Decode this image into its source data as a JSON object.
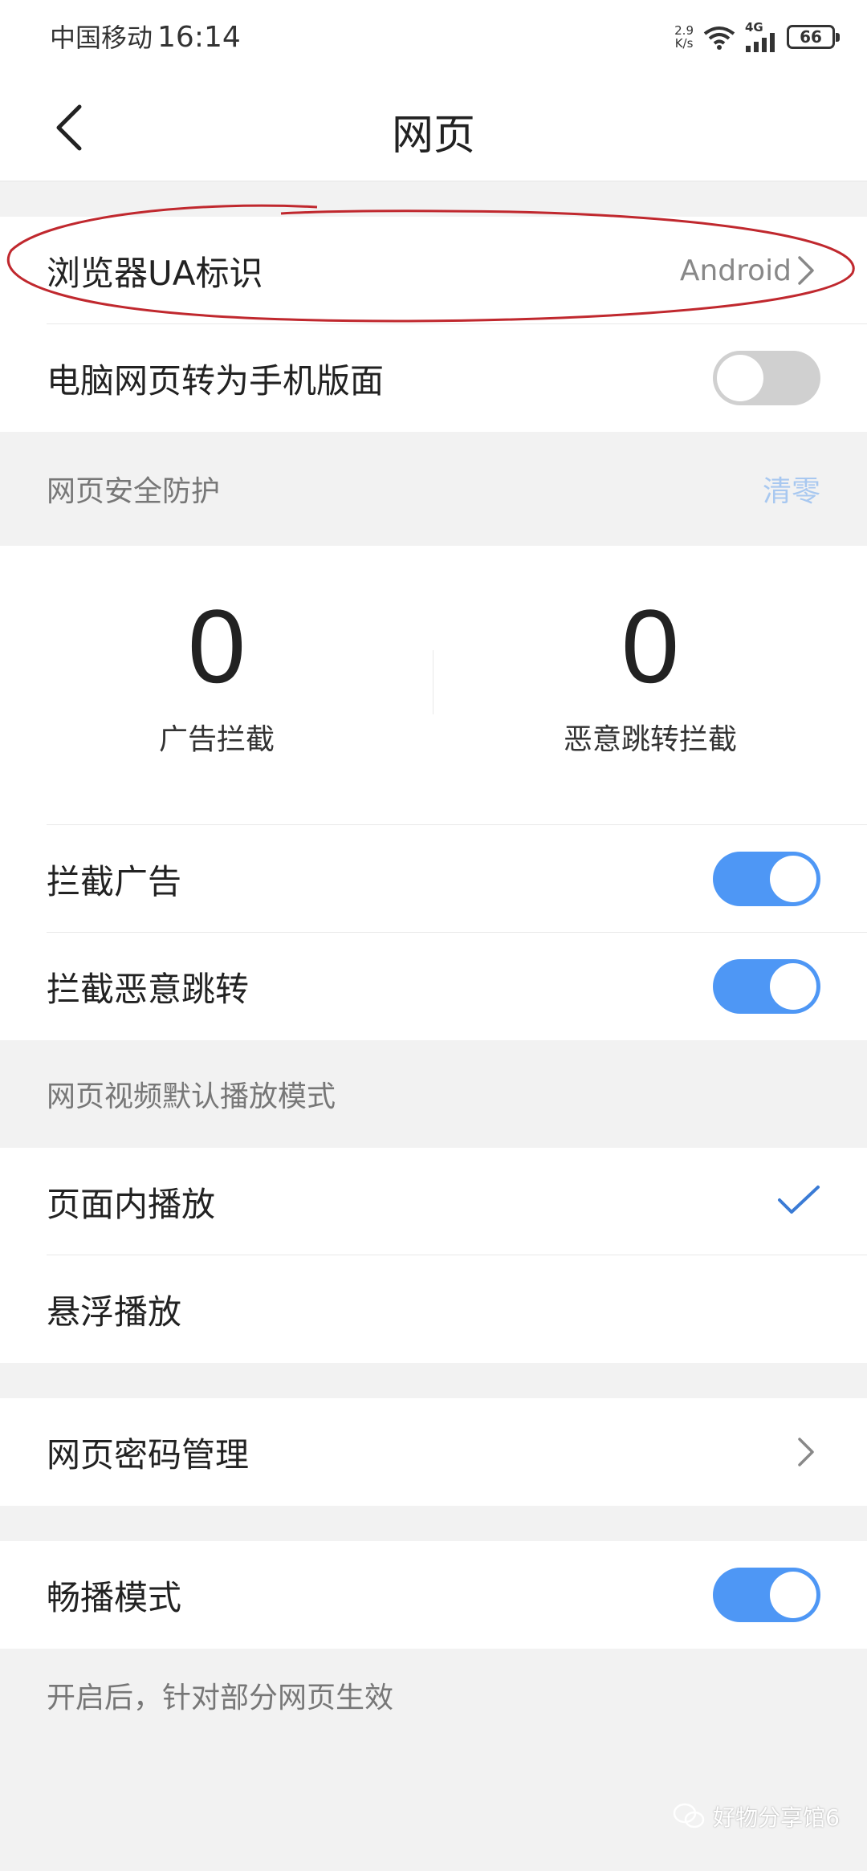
{
  "status_bar": {
    "carrier": "中国移动",
    "time": "16:14",
    "net_speed_value": "2.9",
    "net_speed_unit": "K/s",
    "network": "4G",
    "battery": "66"
  },
  "header": {
    "title": "网页"
  },
  "ua": {
    "label": "浏览器UA标识",
    "value": "Android"
  },
  "mobile_view": {
    "label": "电脑网页转为手机版面",
    "enabled": false
  },
  "security": {
    "section_title": "网页安全防护",
    "clear_label": "清零",
    "ads_blocked_count": "0",
    "ads_blocked_label": "广告拦截",
    "redirects_blocked_count": "0",
    "redirects_blocked_label": "恶意跳转拦截",
    "block_ads_label": "拦截广告",
    "block_ads_enabled": true,
    "block_redirects_label": "拦截恶意跳转",
    "block_redirects_enabled": true
  },
  "video": {
    "section_title": "网页视频默认播放模式",
    "options": [
      {
        "label": "页面内播放",
        "selected": true
      },
      {
        "label": "悬浮播放",
        "selected": false
      }
    ]
  },
  "password": {
    "label": "网页密码管理"
  },
  "smooth": {
    "label": "畅播模式",
    "enabled": true,
    "note": "开启后，针对部分网页生效"
  },
  "watermark": {
    "text": "好物分享馆6"
  },
  "colors": {
    "accent": "#4e97f5",
    "toggle_off": "#d0d0d0",
    "clear_link": "#a8c8f0",
    "annotation": "#c0282e"
  }
}
